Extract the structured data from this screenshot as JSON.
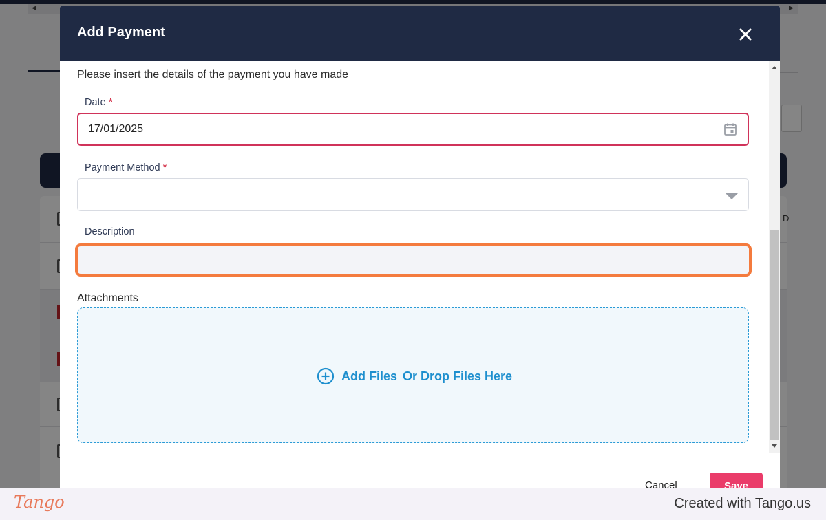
{
  "modal": {
    "title": "Add Payment",
    "intro": "Please insert the details of the payment you have made"
  },
  "form": {
    "date": {
      "label": "Date",
      "required_mark": "*",
      "value": "17/01/2025"
    },
    "payment_method": {
      "label": "Payment Method",
      "required_mark": "*",
      "value": ""
    },
    "description": {
      "label": "Description",
      "value": ""
    },
    "attachments": {
      "label": "Attachments",
      "add_files": "Add Files",
      "drop_text": "Or Drop Files Here"
    }
  },
  "actions": {
    "cancel_label": "Cancel",
    "save_label": "Save"
  },
  "footer": {
    "logo_text": "Tango",
    "credit_text": "Created with Tango.us"
  },
  "background": {
    "column_letter": "D"
  },
  "colors": {
    "header_bg": "#1f2a44",
    "save_bg": "#ea3c6a",
    "highlight_border": "#f47b3e",
    "dropzone_accent": "#1e8fce",
    "required_red": "#d0203a"
  }
}
